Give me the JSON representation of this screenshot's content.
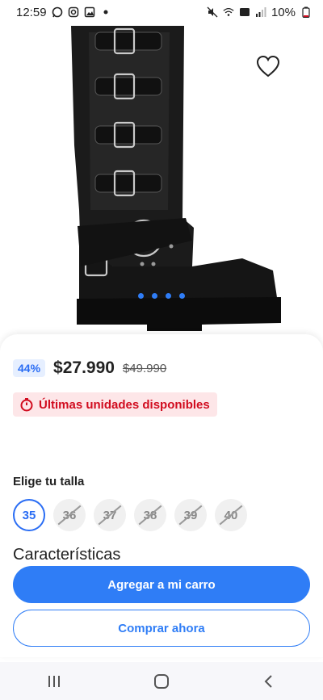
{
  "status_bar": {
    "time": "12:59",
    "battery": "10%"
  },
  "product": {
    "discount": "44%",
    "price": "$27.990",
    "original_price": "$49.990",
    "stock_alert": "Últimas unidades disponibles"
  },
  "sizes": {
    "label": "Elige tu talla",
    "options": [
      {
        "label": "35",
        "state": "selected"
      },
      {
        "label": "36",
        "state": "unavailable"
      },
      {
        "label": "37",
        "state": "unavailable"
      },
      {
        "label": "38",
        "state": "unavailable"
      },
      {
        "label": "39",
        "state": "unavailable"
      },
      {
        "label": "40",
        "state": "unavailable"
      }
    ]
  },
  "features": {
    "title": "Características"
  },
  "actions": {
    "add_to_cart": "Agregar a mi carro",
    "buy_now": "Comprar ahora"
  },
  "gallery": {
    "image_count": 4,
    "current_index": 1
  },
  "colors": {
    "accent": "#2f7df6",
    "alert_text": "#d10c1f",
    "alert_bg": "#fde6e8",
    "badge_bg": "#e6efff"
  },
  "icons": {
    "favorite": "heart-outline-icon",
    "alert": "timer-icon",
    "nav_recent": "recent-apps-icon",
    "nav_home": "home-icon",
    "nav_back": "back-icon"
  }
}
